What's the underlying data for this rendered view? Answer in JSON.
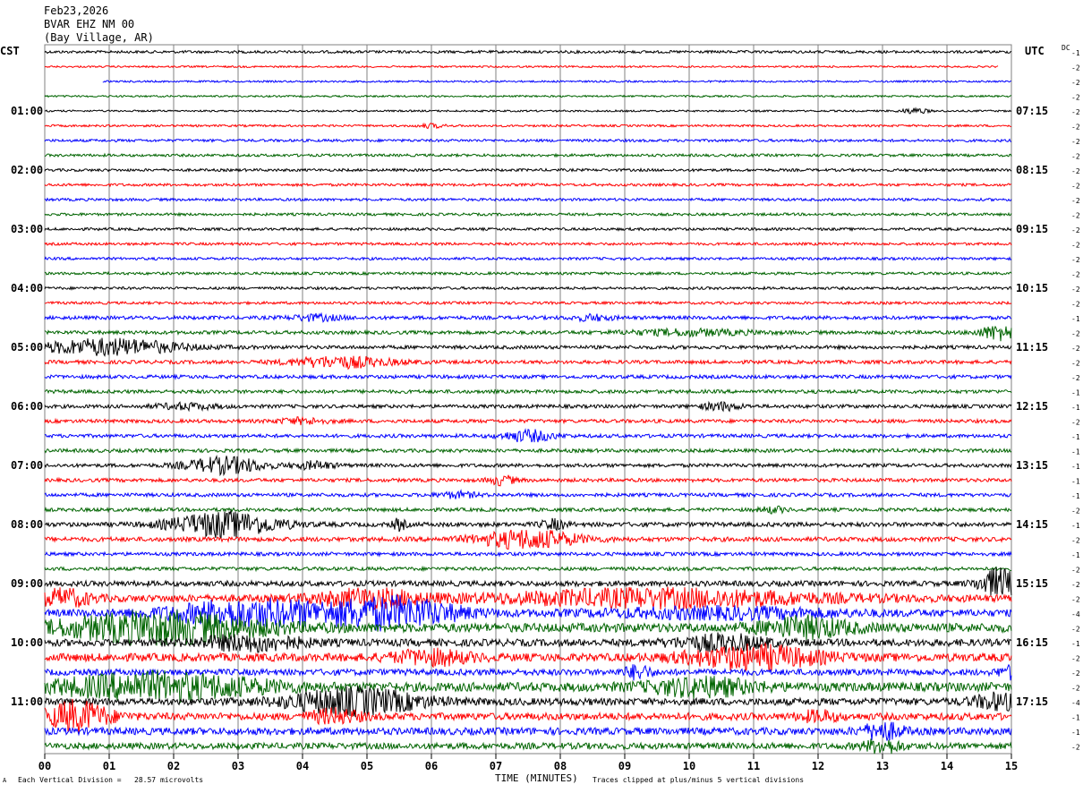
{
  "header": {
    "date": "Feb23,2026",
    "station": "BVAR EHZ NM 00",
    "location": "(Bay Village, AR)"
  },
  "left_axis_label": "CST",
  "right_axis_label": "UTC",
  "dc_label": "DC",
  "footer": {
    "scale_note": "Each Vertical Division =   28.57 microvolts",
    "xlabel": "TIME (MINUTES)",
    "clip_note": "Traces clipped at plus/minus 5 vertical divisions",
    "corner_mark": "A"
  },
  "colors": {
    "black": "#000000",
    "red": "#ff0000",
    "blue": "#0000ff",
    "green": "#006400",
    "grid": "#808080"
  },
  "chart_data": {
    "type": "line",
    "xlabel": "TIME (MINUTES)",
    "x_ticks": [
      "00",
      "01",
      "02",
      "03",
      "04",
      "05",
      "06",
      "07",
      "08",
      "09",
      "10",
      "11",
      "12",
      "13",
      "14",
      "15"
    ],
    "xlim": [
      0,
      15
    ],
    "minutes_per_row": 15,
    "color_cycle": [
      "black",
      "red",
      "blue",
      "green"
    ],
    "left_hour_labels": [
      "01:00",
      "02:00",
      "03:00",
      "04:00",
      "05:00",
      "06:00",
      "07:00",
      "08:00",
      "09:00",
      "10:00",
      "11:00"
    ],
    "right_hour_labels": [
      "07:15",
      "08:15",
      "09:15",
      "10:15",
      "11:15",
      "12:15",
      "13:15",
      "14:15",
      "15:15",
      "16:15",
      "17:15"
    ],
    "dc_offsets": [
      "-1",
      "-2",
      "-2",
      "-2",
      "-2",
      "-2",
      "-2",
      "-2",
      "-2",
      "-2",
      "-2",
      "-2",
      "-2",
      "-2",
      "-2",
      "-2",
      "-2",
      "-2",
      "-1",
      "-2",
      "-2",
      "-2",
      "-2",
      "-1",
      "-1",
      "-2",
      "-1",
      "-1",
      "-1",
      "-1",
      "-1",
      "-2",
      "-1",
      "-2",
      "-1",
      "-2",
      "-2",
      "-2",
      "-4",
      "-2",
      "-1",
      "-2",
      "-2",
      "-2",
      "-4",
      "-1",
      "-1",
      "-2",
      "-2"
    ],
    "rows": [
      {
        "amp": 1.5,
        "events": []
      },
      {
        "amp": 1,
        "start": 0,
        "end": 14.8,
        "events": []
      },
      {
        "amp": 1,
        "start": 0.9,
        "events": []
      },
      {
        "amp": 1,
        "events": []
      },
      {
        "amp": 1,
        "events": [
          {
            "t": 13.5,
            "a": 3,
            "w": 0.2
          }
        ]
      },
      {
        "amp": 1.2,
        "events": [
          {
            "t": 6.0,
            "a": 2,
            "w": 0.2
          }
        ]
      },
      {
        "amp": 1.5,
        "events": []
      },
      {
        "amp": 1.5,
        "events": []
      },
      {
        "amp": 1.5,
        "events": []
      },
      {
        "amp": 1.5,
        "events": []
      },
      {
        "amp": 1.5,
        "events": []
      },
      {
        "amp": 1.5,
        "events": []
      },
      {
        "amp": 1.5,
        "events": []
      },
      {
        "amp": 1.5,
        "events": []
      },
      {
        "amp": 1.5,
        "events": []
      },
      {
        "amp": 1.5,
        "events": []
      },
      {
        "amp": 1.5,
        "events": []
      },
      {
        "amp": 1.5,
        "events": []
      },
      {
        "amp": 2,
        "events": [
          {
            "t": 4.2,
            "a": 3,
            "w": 0.4
          },
          {
            "t": 8.5,
            "a": 3,
            "w": 0.3
          }
        ]
      },
      {
        "amp": 2,
        "events": [
          {
            "t": 14.8,
            "a": 8,
            "w": 0.3
          },
          {
            "t": 10.0,
            "a": 3,
            "w": 1.0
          }
        ]
      },
      {
        "amp": 2,
        "events": [
          {
            "t": 1.0,
            "a": 9,
            "w": 1.1
          }
        ]
      },
      {
        "amp": 2,
        "events": [
          {
            "t": 4.6,
            "a": 6,
            "w": 0.8
          }
        ]
      },
      {
        "amp": 2,
        "events": []
      },
      {
        "amp": 2,
        "events": []
      },
      {
        "amp": 2,
        "events": [
          {
            "t": 2.2,
            "a": 3,
            "w": 0.5
          },
          {
            "t": 10.5,
            "a": 4,
            "w": 0.3
          }
        ]
      },
      {
        "amp": 2,
        "events": [
          {
            "t": 4.0,
            "a": 3,
            "w": 0.4
          }
        ]
      },
      {
        "amp": 2,
        "events": [
          {
            "t": 7.5,
            "a": 6,
            "w": 0.4
          }
        ]
      },
      {
        "amp": 2,
        "events": []
      },
      {
        "amp": 2,
        "events": [
          {
            "t": 2.8,
            "a": 9,
            "w": 0.6
          },
          {
            "t": 4.2,
            "a": 4,
            "w": 0.3
          }
        ]
      },
      {
        "amp": 2,
        "events": [
          {
            "t": 7.1,
            "a": 5,
            "w": 0.2
          }
        ]
      },
      {
        "amp": 2,
        "events": [
          {
            "t": 6.4,
            "a": 3,
            "w": 0.3
          }
        ]
      },
      {
        "amp": 2,
        "events": [
          {
            "t": 11.3,
            "a": 3,
            "w": 0.2
          }
        ]
      },
      {
        "amp": 2.5,
        "events": [
          {
            "t": 2.8,
            "a": 14,
            "w": 0.8
          },
          {
            "t": 5.5,
            "a": 6,
            "w": 0.1
          },
          {
            "t": 7.9,
            "a": 5,
            "w": 0.2
          }
        ]
      },
      {
        "amp": 2.5,
        "events": [
          {
            "t": 7.5,
            "a": 10,
            "w": 0.8
          }
        ]
      },
      {
        "amp": 2,
        "events": []
      },
      {
        "amp": 2,
        "events": []
      },
      {
        "amp": 3,
        "events": [
          {
            "t": 14.8,
            "a": 16,
            "w": 0.3
          }
        ]
      },
      {
        "amp": 4,
        "events": [
          {
            "t": 0.3,
            "a": 9,
            "w": 0.4
          },
          {
            "t": 5.0,
            "a": 9,
            "w": 0.8
          },
          {
            "t": 9.5,
            "a": 9,
            "w": 2.5
          }
        ]
      },
      {
        "amp": 4,
        "events": [
          {
            "t": 3.2,
            "a": 14,
            "w": 1.3
          },
          {
            "t": 5.4,
            "a": 16,
            "w": 1.0
          },
          {
            "t": 10.5,
            "a": 5,
            "w": 1.8
          }
        ]
      },
      {
        "amp": 5,
        "events": [
          {
            "t": 1.8,
            "a": 16,
            "w": 1.6
          },
          {
            "t": 11.8,
            "a": 10,
            "w": 0.7
          }
        ]
      },
      {
        "amp": 4,
        "events": [
          {
            "t": 3.2,
            "a": 8,
            "w": 0.8
          },
          {
            "t": 10.5,
            "a": 8,
            "w": 0.7
          }
        ]
      },
      {
        "amp": 4.5,
        "events": [
          {
            "t": 6.0,
            "a": 7,
            "w": 0.6
          },
          {
            "t": 11.0,
            "a": 12,
            "w": 1.0
          }
        ]
      },
      {
        "amp": 3.5,
        "events": [
          {
            "t": 9.2,
            "a": 7,
            "w": 0.2
          },
          {
            "t": 15.0,
            "a": 6,
            "w": 0.2
          }
        ]
      },
      {
        "amp": 5,
        "events": [
          {
            "t": 1.8,
            "a": 14,
            "w": 1.6
          },
          {
            "t": 10.2,
            "a": 9,
            "w": 0.8
          }
        ]
      },
      {
        "amp": 4,
        "events": [
          {
            "t": 4.8,
            "a": 14,
            "w": 1.0
          },
          {
            "t": 14.8,
            "a": 8,
            "w": 0.4
          }
        ]
      },
      {
        "amp": 4,
        "events": [
          {
            "t": 0.5,
            "a": 16,
            "w": 0.5
          },
          {
            "t": 4.5,
            "a": 7,
            "w": 0.4
          },
          {
            "t": 12.0,
            "a": 5,
            "w": 0.3
          }
        ]
      },
      {
        "amp": 4,
        "events": [
          {
            "t": 13.0,
            "a": 9,
            "w": 0.3
          }
        ]
      },
      {
        "amp": 3.5,
        "events": [
          {
            "t": 13.0,
            "a": 7,
            "w": 0.3
          }
        ]
      }
    ]
  }
}
